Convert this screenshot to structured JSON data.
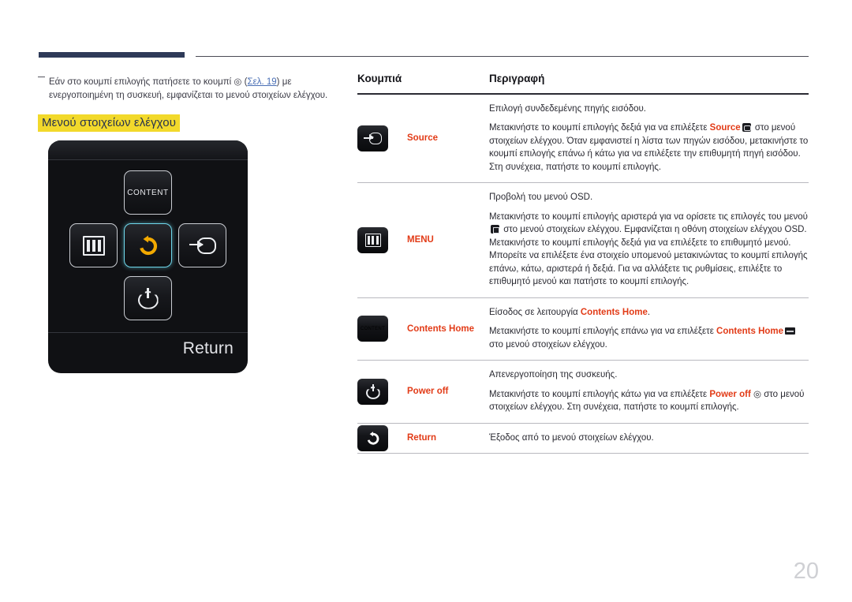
{
  "document": {
    "page_number": "20",
    "accent_bar_color": "#2e3a58",
    "highlight_color": "#f2d92b",
    "link_color": "#4a6fb5",
    "term_color": "#e23b17"
  },
  "note": {
    "text_before_link": "Εάν στο κουμπί επιλογής πατήσετε το κουμπί ◎ (",
    "link_label": "Σελ. 19",
    "text_after_link": ") με ενεργοποιημένη τη συσκευή, εμφανίζεται το μενού στοιχείων ελέγχου."
  },
  "section": {
    "heading": "Μενού στοιχείων ελέγχου"
  },
  "device_panel": {
    "return_label": "Return",
    "keys": [
      {
        "name": "content",
        "label": "CONTENT",
        "icon": "content-icon",
        "position": "top",
        "selected": false
      },
      {
        "name": "menu",
        "label": "",
        "icon": "menu-icon",
        "position": "left",
        "selected": false
      },
      {
        "name": "return",
        "label": "",
        "icon": "return-icon",
        "position": "center",
        "selected": true
      },
      {
        "name": "source",
        "label": "",
        "icon": "source-icon",
        "position": "right",
        "selected": false
      },
      {
        "name": "power",
        "label": "",
        "icon": "power-icon",
        "position": "bottom",
        "selected": false
      }
    ],
    "selected_highlight_color": "#6fd8ec",
    "return_arrow_color": "#f2a900"
  },
  "table": {
    "headers": {
      "buttons": "Κουμπιά",
      "description": "Περιγραφή"
    },
    "rows": [
      {
        "icon": "source-icon",
        "name": "Source",
        "paragraphs": [
          {
            "segments": [
              {
                "t": "Επιλογή συνδεδεμένης πηγής εισόδου."
              }
            ]
          },
          {
            "segments": [
              {
                "t": "Μετακινήστε το κουμπί επιλογής δεξιά για να επιλέξετε "
              },
              {
                "t": "Source",
                "hl": true
              },
              {
                "icon": "source-mini-icon"
              },
              {
                "t": " στο μενού στοιχείων ελέγχου. Όταν εμφανιστεί η λίστα των πηγών εισόδου, μετακινήστε το κουμπί επιλογής επάνω ή κάτω για να επιλέξετε την επιθυμητή πηγή εισόδου. Στη συνέχεια, πατήστε το κουμπί επιλογής."
              }
            ]
          }
        ]
      },
      {
        "icon": "menu-icon",
        "name": "MENU",
        "paragraphs": [
          {
            "segments": [
              {
                "t": "Προβολή του μενού OSD."
              }
            ]
          },
          {
            "segments": [
              {
                "t": "Μετακινήστε το κουμπί επιλογής αριστερά για να ορίσετε τις επιλογές του μενού "
              },
              {
                "icon": "menu-mini-icon"
              },
              {
                "t": " στο μενού στοιχείων ελέγχου. Εμφανίζεται η οθόνη στοιχείων ελέγχου OSD. Μετακινήστε το κουμπί επιλογής δεξιά για να επιλέξετε το επιθυμητό μενού. Μπορείτε να επιλέξετε ένα στοιχείο υπομενού μετακινώντας το κουμπί επιλογής επάνω, κάτω, αριστερά ή δεξιά. Για να αλλάξετε τις ρυθμίσεις, επιλέξτε το επιθυμητό μενού και πατήστε το κουμπί επιλογής."
              }
            ]
          }
        ]
      },
      {
        "icon": "content-icon",
        "name": "Contents Home",
        "paragraphs": [
          {
            "segments": [
              {
                "t": "Είσοδος σε λειτουργία "
              },
              {
                "t": "Contents Home",
                "hl": true
              },
              {
                "t": "."
              }
            ]
          },
          {
            "segments": [
              {
                "t": "Μετακινήστε το κουμπί επιλογής επάνω για να επιλέξετε "
              },
              {
                "t": "Contents Home",
                "hl": true
              },
              {
                "icon": "content-mini-icon"
              },
              {
                "t": " στο μενού στοιχείων ελέγχου."
              }
            ]
          }
        ]
      },
      {
        "icon": "power-icon",
        "name": "Power off",
        "paragraphs": [
          {
            "segments": [
              {
                "t": "Απενεργοποίηση της συσκευής."
              }
            ]
          },
          {
            "segments": [
              {
                "t": "Μετακινήστε το κουμπί επιλογής κάτω για να επιλέξετε "
              },
              {
                "t": "Power off",
                "hl": true
              },
              {
                "t": " ◎ "
              },
              {
                "t": "στο μενού στοιχείων ελέγχου. Στη συνέχεια, πατήστε το κουμπί επιλογής."
              }
            ]
          }
        ]
      },
      {
        "icon": "return-icon",
        "name": "Return",
        "paragraphs": [
          {
            "segments": [
              {
                "t": "Έξοδος από το μενού στοιχείων ελέγχου."
              }
            ]
          }
        ]
      }
    ]
  }
}
